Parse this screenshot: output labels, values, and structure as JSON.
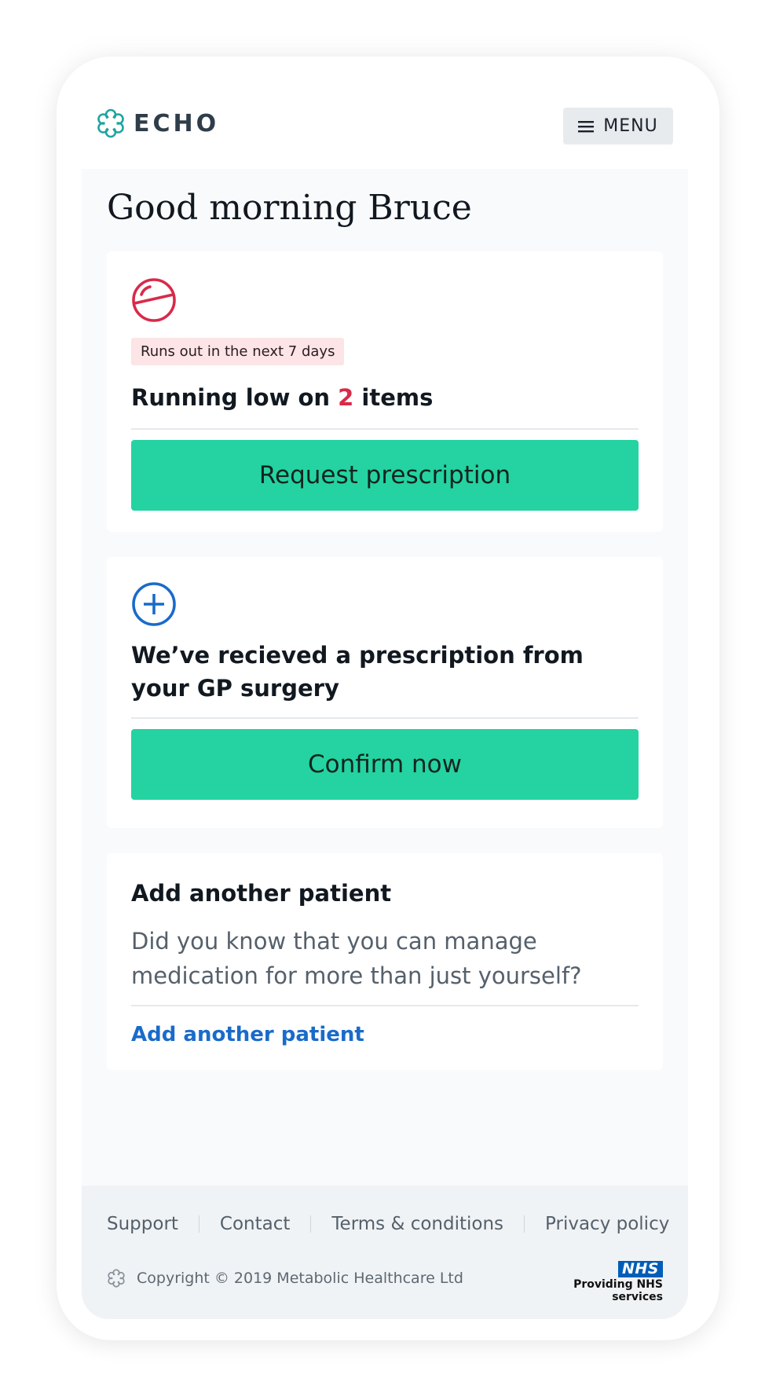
{
  "brand": {
    "name": "ECHO",
    "accent": "#1fa4a0"
  },
  "header": {
    "menu_label": "MENU"
  },
  "greeting": "Good morning Bruce",
  "cards": {
    "low_stock": {
      "badge": "Runs out in the next 7 days",
      "title_prefix": "Running low on ",
      "count": "2",
      "title_suffix": " items",
      "button": "Request prescription",
      "icon": "pill-icon",
      "icon_color": "#d82a4a"
    },
    "prescription": {
      "title": "We’ve recieved a prescription from your GP surgery",
      "button": "Confirm now",
      "icon": "plus-circle-icon",
      "icon_color": "#1a6bc9"
    },
    "add_patient": {
      "title": "Add another patient",
      "body": "Did you know that you can manage medication for more than just yourself?",
      "link": "Add another patient"
    }
  },
  "colors": {
    "cta": "#24d3a1",
    "link": "#1a6bc9",
    "danger": "#d82a4a"
  },
  "footer": {
    "links": [
      "Support",
      "Contact",
      "Terms & conditions",
      "Privacy policy"
    ],
    "copyright": "Copyright © 2019 Metabolic Healthcare Ltd",
    "nhs_logo": "NHS",
    "nhs_text": "Providing NHS services"
  }
}
